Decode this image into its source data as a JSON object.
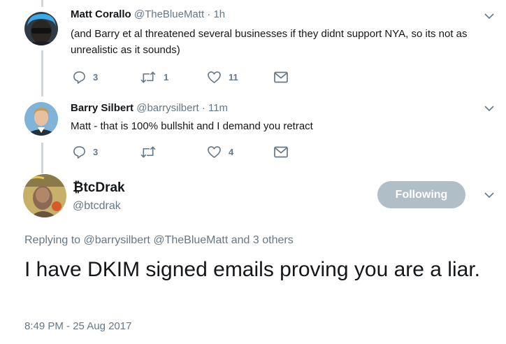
{
  "colors": {
    "text_primary": "#14171a",
    "text_secondary": "#657786",
    "thread_line": "#ccd6dd",
    "follow_button_bg": "#b0bec8"
  },
  "tweets": [
    {
      "name": "Matt Corallo",
      "handle": "@TheBlueMatt",
      "separator": "·",
      "time": "1h",
      "text": "(and Barry et al threatened several businesses if they didnt support NYA, so its not as unrealistic as it sounds)",
      "reply_count": "3",
      "retweet_count": "1",
      "like_count": "11"
    },
    {
      "name": "Barry Silbert",
      "handle": "@barrysilbert",
      "separator": "·",
      "time": "11m",
      "text": "Matt - that is 100% bullshit and I demand you retract",
      "reply_count": "3",
      "retweet_count": "",
      "like_count": "4"
    }
  ],
  "main_tweet": {
    "name": "₿tcDrak",
    "handle": "@btcdrak",
    "follow_label": "Following",
    "replying_prefix": "Replying to",
    "replying_mentions": [
      "@barrysilbert",
      "@TheBlueMatt"
    ],
    "replying_suffix": "and 3 others",
    "text": "I have DKIM signed emails proving you are a liar.",
    "timestamp": "8:49 PM - 25 Aug 2017"
  },
  "icons": {
    "reply": "reply-icon",
    "retweet": "retweet-icon",
    "like": "heart-icon",
    "dm": "envelope-icon",
    "more": "chevron-down-icon"
  }
}
